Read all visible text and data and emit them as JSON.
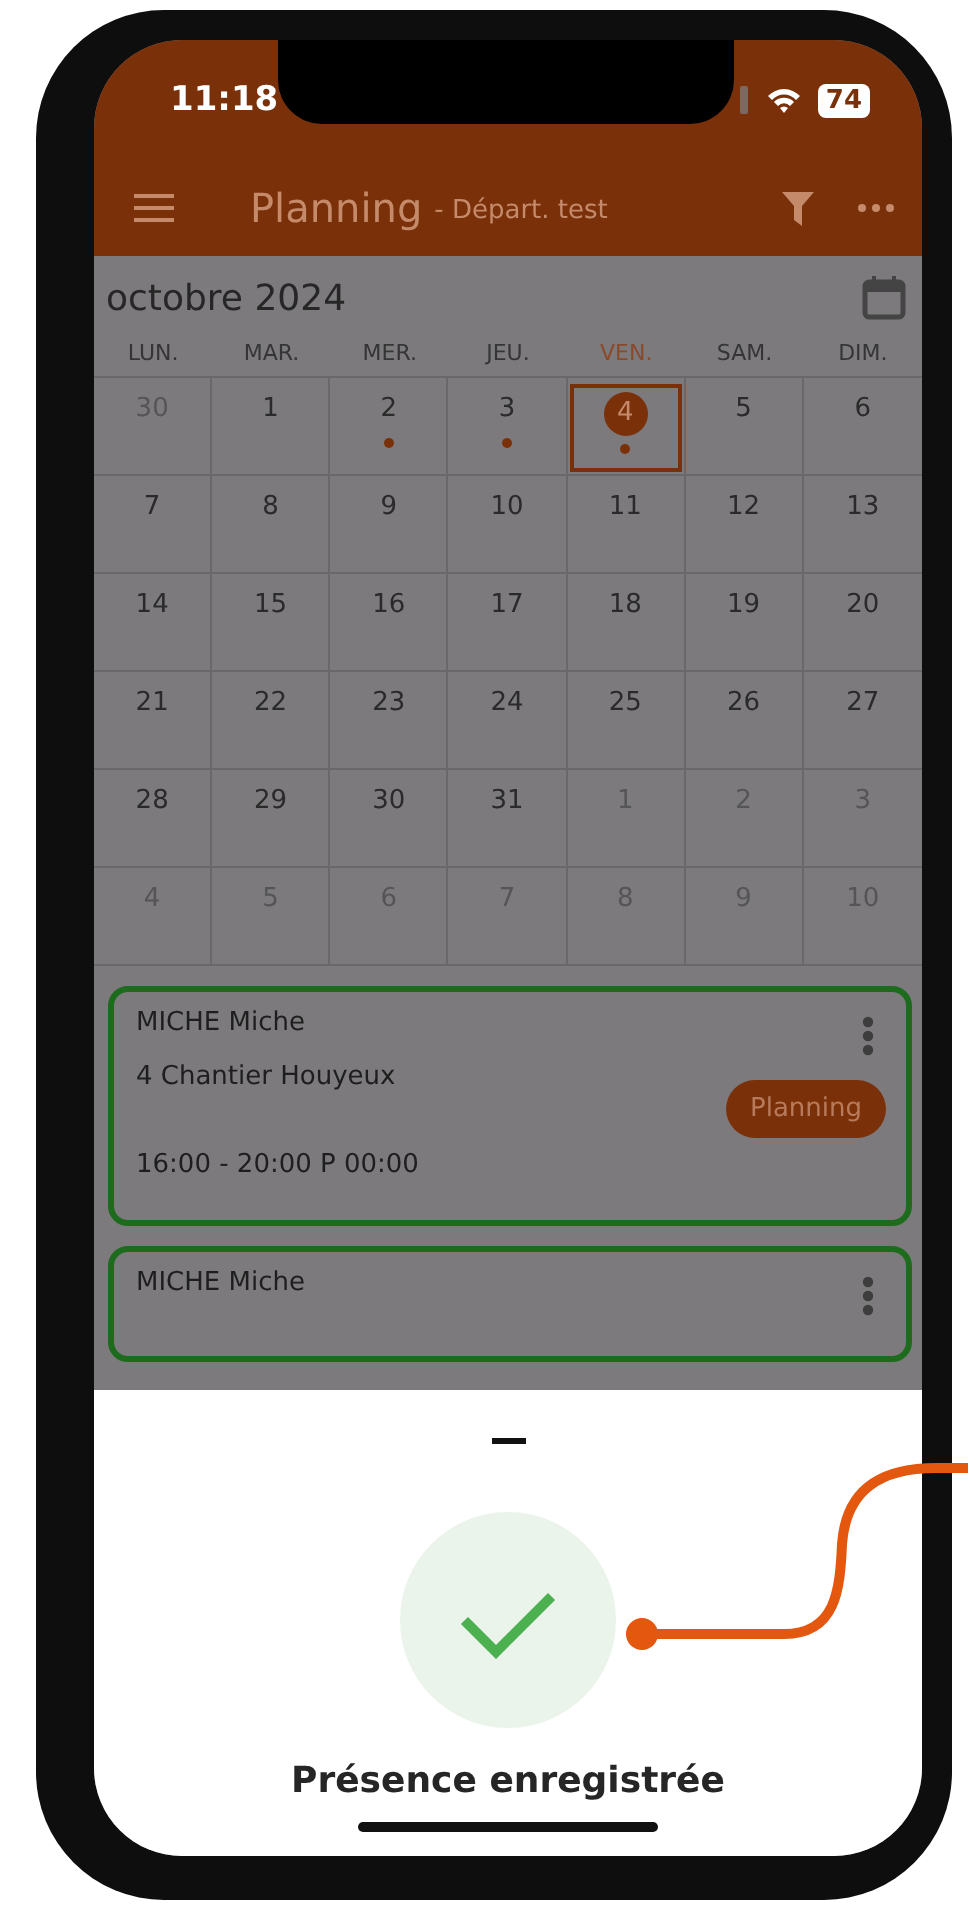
{
  "status_bar": {
    "time": "11:18",
    "battery": "74"
  },
  "header": {
    "title": "Planning",
    "subtitle": "- Départ. test"
  },
  "calendar": {
    "month": "octobre 2024",
    "weekdays": [
      {
        "label": "LUN.",
        "current": false
      },
      {
        "label": "MAR.",
        "current": false
      },
      {
        "label": "MER.",
        "current": false
      },
      {
        "label": "JEU.",
        "current": false
      },
      {
        "label": "VEN.",
        "current": true
      },
      {
        "label": "SAM.",
        "current": false
      },
      {
        "label": "DIM.",
        "current": false
      }
    ],
    "weeks": [
      [
        {
          "day": "30",
          "outside": true,
          "event": false,
          "selected": false
        },
        {
          "day": "1",
          "outside": false,
          "event": false,
          "selected": false
        },
        {
          "day": "2",
          "outside": false,
          "event": true,
          "selected": false
        },
        {
          "day": "3",
          "outside": false,
          "event": true,
          "selected": false
        },
        {
          "day": "4",
          "outside": false,
          "event": true,
          "selected": true
        },
        {
          "day": "5",
          "outside": false,
          "event": false,
          "selected": false
        },
        {
          "day": "6",
          "outside": false,
          "event": false,
          "selected": false
        }
      ],
      [
        {
          "day": "7",
          "outside": false,
          "event": false,
          "selected": false
        },
        {
          "day": "8",
          "outside": false,
          "event": false,
          "selected": false
        },
        {
          "day": "9",
          "outside": false,
          "event": false,
          "selected": false
        },
        {
          "day": "10",
          "outside": false,
          "event": false,
          "selected": false
        },
        {
          "day": "11",
          "outside": false,
          "event": false,
          "selected": false
        },
        {
          "day": "12",
          "outside": false,
          "event": false,
          "selected": false
        },
        {
          "day": "13",
          "outside": false,
          "event": false,
          "selected": false
        }
      ],
      [
        {
          "day": "14",
          "outside": false,
          "event": false,
          "selected": false
        },
        {
          "day": "15",
          "outside": false,
          "event": false,
          "selected": false
        },
        {
          "day": "16",
          "outside": false,
          "event": false,
          "selected": false
        },
        {
          "day": "17",
          "outside": false,
          "event": false,
          "selected": false
        },
        {
          "day": "18",
          "outside": false,
          "event": false,
          "selected": false
        },
        {
          "day": "19",
          "outside": false,
          "event": false,
          "selected": false
        },
        {
          "day": "20",
          "outside": false,
          "event": false,
          "selected": false
        }
      ],
      [
        {
          "day": "21",
          "outside": false,
          "event": false,
          "selected": false
        },
        {
          "day": "22",
          "outside": false,
          "event": false,
          "selected": false
        },
        {
          "day": "23",
          "outside": false,
          "event": false,
          "selected": false
        },
        {
          "day": "24",
          "outside": false,
          "event": false,
          "selected": false
        },
        {
          "day": "25",
          "outside": false,
          "event": false,
          "selected": false
        },
        {
          "day": "26",
          "outside": false,
          "event": false,
          "selected": false
        },
        {
          "day": "27",
          "outside": false,
          "event": false,
          "selected": false
        }
      ],
      [
        {
          "day": "28",
          "outside": false,
          "event": false,
          "selected": false
        },
        {
          "day": "29",
          "outside": false,
          "event": false,
          "selected": false
        },
        {
          "day": "30",
          "outside": false,
          "event": false,
          "selected": false
        },
        {
          "day": "31",
          "outside": false,
          "event": false,
          "selected": false
        },
        {
          "day": "1",
          "outside": true,
          "event": false,
          "selected": false
        },
        {
          "day": "2",
          "outside": true,
          "event": false,
          "selected": false
        },
        {
          "day": "3",
          "outside": true,
          "event": false,
          "selected": false
        }
      ],
      [
        {
          "day": "4",
          "outside": true,
          "event": false,
          "selected": false
        },
        {
          "day": "5",
          "outside": true,
          "event": false,
          "selected": false
        },
        {
          "day": "6",
          "outside": true,
          "event": false,
          "selected": false
        },
        {
          "day": "7",
          "outside": true,
          "event": false,
          "selected": false
        },
        {
          "day": "8",
          "outside": true,
          "event": false,
          "selected": false
        },
        {
          "day": "9",
          "outside": true,
          "event": false,
          "selected": false
        },
        {
          "day": "10",
          "outside": true,
          "event": false,
          "selected": false
        }
      ]
    ]
  },
  "events": [
    {
      "name": "MICHE Miche",
      "site": "4 Chantier Houyeux",
      "button": "Planning",
      "time": "16:00 - 20:00 P 00:00"
    },
    {
      "name": "MICHE Miche"
    }
  ],
  "sheet": {
    "message": "Présence enregistrée"
  }
}
